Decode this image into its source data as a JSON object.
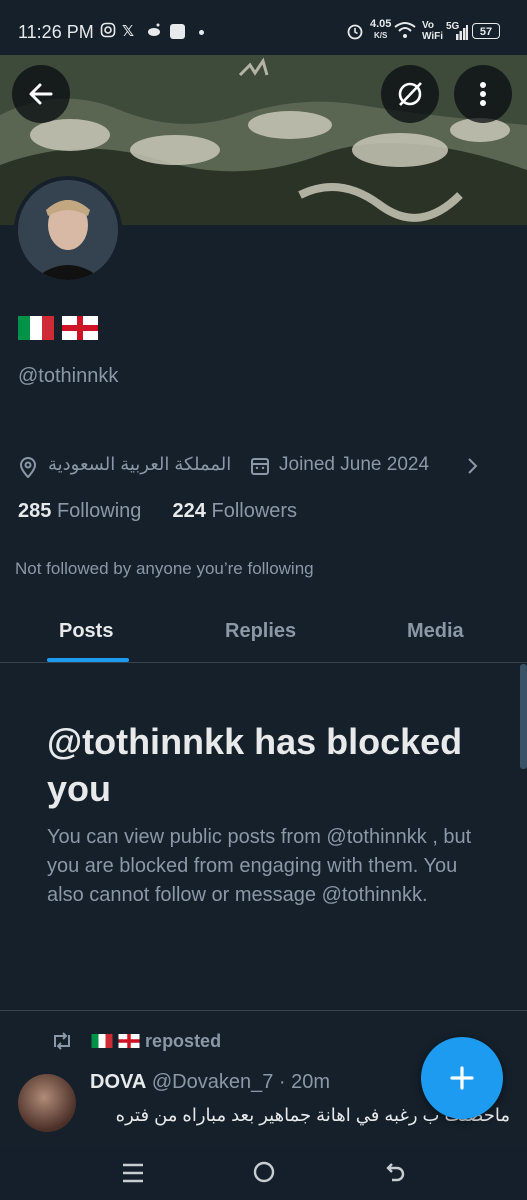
{
  "status_bar": {
    "time": "11:26 PM",
    "network_speed_value": "4.05",
    "network_speed_unit": "K/S",
    "volte": "Vo",
    "wifi_label": "WiFi",
    "signal": "5G",
    "battery": "57"
  },
  "profile": {
    "handle": "@tothinnkk",
    "location": "المملكة العربية السعودية",
    "joined": "Joined June 2024",
    "following_count": "285",
    "following_label": "Following",
    "followers_count": "224",
    "followers_label": "Followers",
    "not_followed_text": "Not followed by anyone you’re following"
  },
  "tabs": [
    {
      "label": "Posts",
      "active": true
    },
    {
      "label": "Replies",
      "active": false
    },
    {
      "label": "Media",
      "active": false
    }
  ],
  "blocked": {
    "title": "@tothinnkk has blocked you",
    "description": "You can view public posts from @tothinnkk , but you are blocked from engaging with them. You also cannot follow or message @tothinnkk."
  },
  "post": {
    "reposted_label": "reposted",
    "author_name": "DOVA",
    "author_handle": "@Dovaken_7",
    "separator": "·",
    "time": "20m",
    "text": "ماحصلت ب رغبه في اهانة جماهير بعد مباراه من فتره"
  },
  "colors": {
    "background": "#15202b",
    "accent": "#1d9bf0",
    "secondary_text": "#8b98a5"
  },
  "icons": [
    "back-arrow-icon",
    "refresh-off-icon",
    "more-vertical-icon",
    "location-pin-icon",
    "calendar-icon",
    "chevron-right-icon",
    "repost-icon",
    "plus-icon"
  ]
}
